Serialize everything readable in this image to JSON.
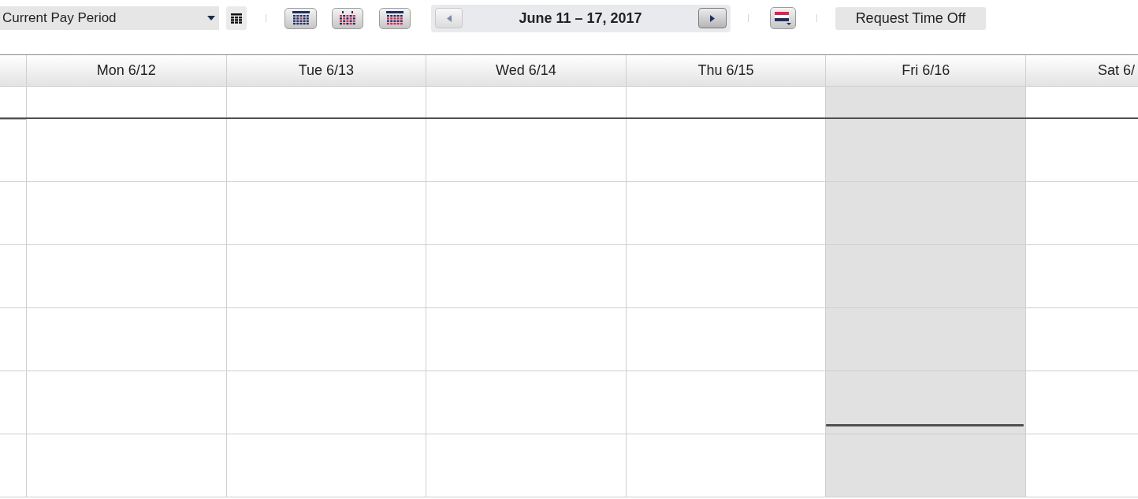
{
  "toolbar": {
    "period_select": {
      "value": "Current Pay Period"
    },
    "date_nav": {
      "prev": {
        "disabled": true
      },
      "label": "June 11 – 17, 2017",
      "next": {
        "disabled": false
      }
    },
    "request_button": {
      "label": "Request Time Off"
    }
  },
  "calendar": {
    "days": [
      {
        "label": "Mon 6/12",
        "today": false
      },
      {
        "label": "Tue 6/13",
        "today": false
      },
      {
        "label": "Wed 6/14",
        "today": false
      },
      {
        "label": "Thu 6/15",
        "today": false
      },
      {
        "label": "Fri 6/16",
        "today": true
      },
      {
        "label": "Sat 6/",
        "today": false
      }
    ]
  }
}
